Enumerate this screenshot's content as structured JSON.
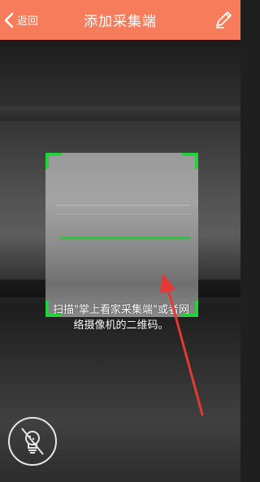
{
  "header": {
    "back_label": "返回",
    "title": "添加采集端"
  },
  "scanner": {
    "hint_line1": "扫描\"掌上看家采集端\"或者网",
    "hint_line2": "络摄像机的二维码。",
    "frame_color": "#22d43a",
    "scan_line_color": "#29c43a"
  },
  "colors": {
    "header_bg": "#f77c5c",
    "annotation_arrow": "#e53935"
  },
  "icons": {
    "back": "chevron-left-icon",
    "edit": "pencil-icon",
    "flashlight": "flashlight-off-icon"
  }
}
